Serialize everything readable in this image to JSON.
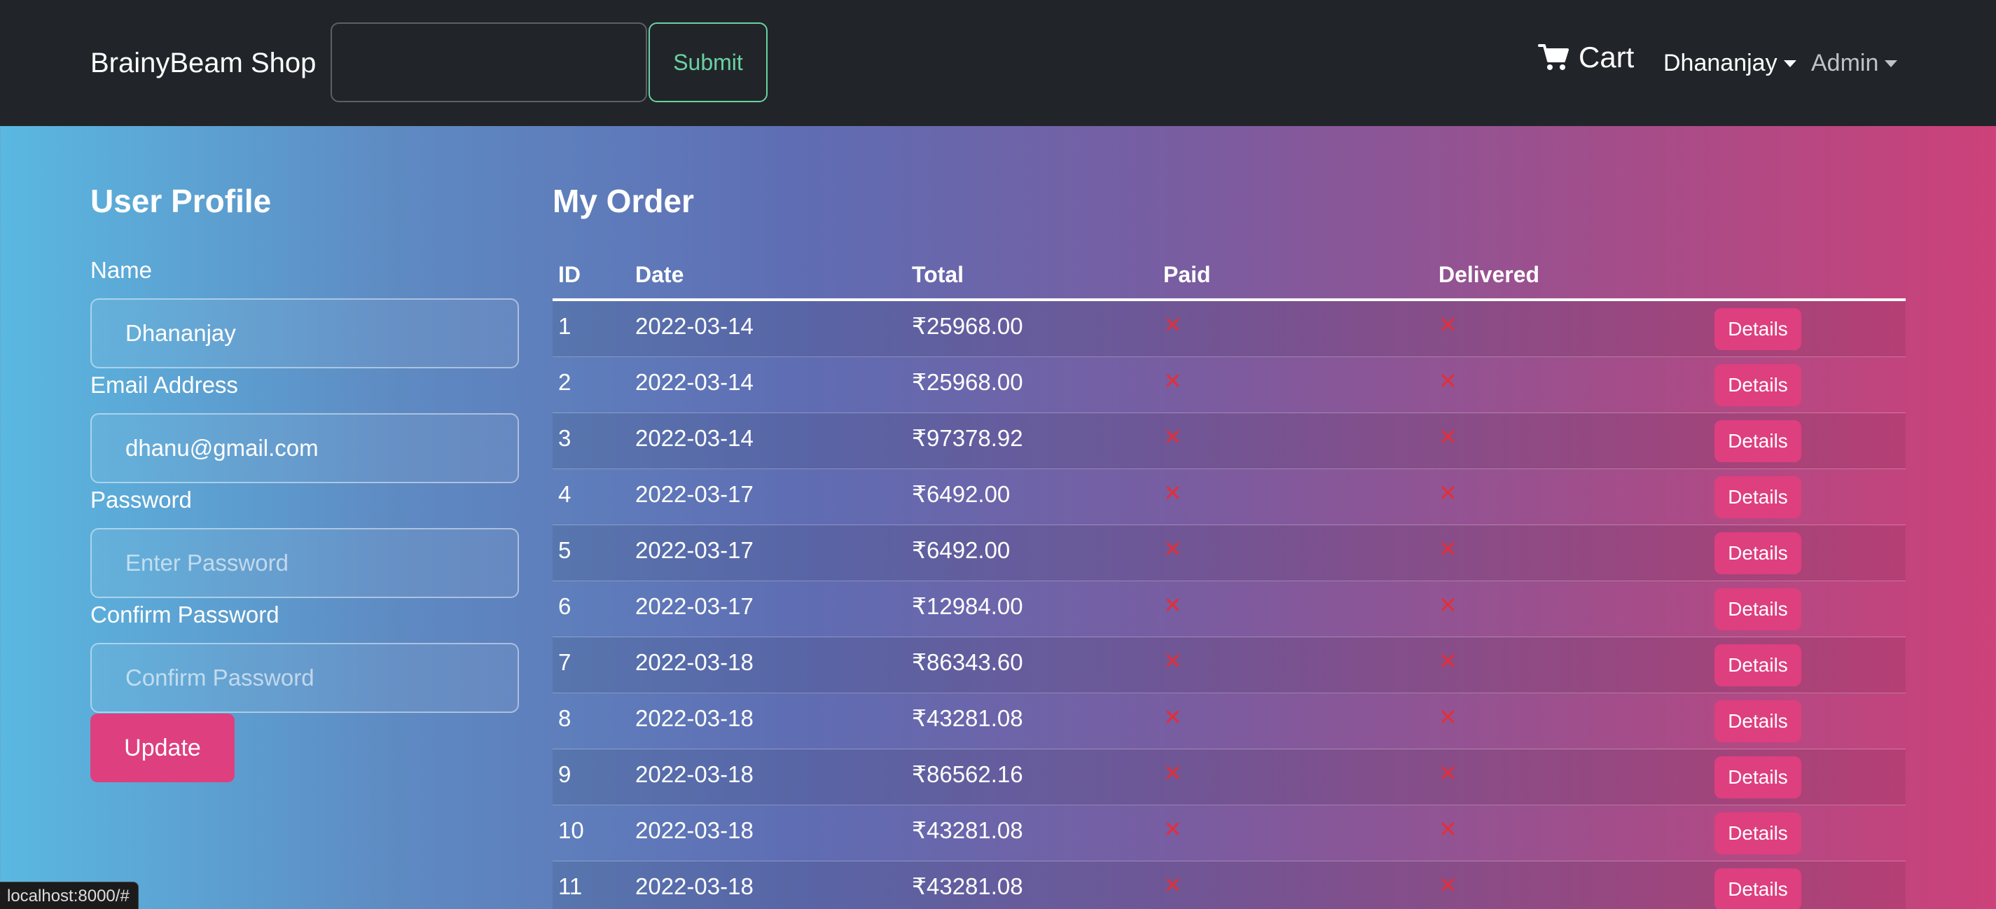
{
  "navbar": {
    "brand": "BrainyBeam Shop",
    "search_value": "",
    "submit_label": "Submit",
    "cart_label": "Cart",
    "user_label": "Dhananjay",
    "admin_label": "Admin"
  },
  "profile": {
    "title": "User Profile",
    "name_label": "Name",
    "name_value": "Dhananjay",
    "email_label": "Email Address",
    "email_value": "dhanu@gmail.com",
    "password_label": "Password",
    "password_placeholder": "Enter Password",
    "confirm_label": "Confirm Password",
    "confirm_placeholder": "Confirm Password",
    "update_label": "Update"
  },
  "orders": {
    "title": "My Order",
    "columns": [
      "ID",
      "Date",
      "Total",
      "Paid",
      "Delivered"
    ],
    "details_label": "Details",
    "status_mark": "✕",
    "rows": [
      {
        "id": "1",
        "date": "2022-03-14",
        "total": "₹25968.00",
        "paid": false,
        "delivered": false
      },
      {
        "id": "2",
        "date": "2022-03-14",
        "total": "₹25968.00",
        "paid": false,
        "delivered": false
      },
      {
        "id": "3",
        "date": "2022-03-14",
        "total": "₹97378.92",
        "paid": false,
        "delivered": false
      },
      {
        "id": "4",
        "date": "2022-03-17",
        "total": "₹6492.00",
        "paid": false,
        "delivered": false
      },
      {
        "id": "5",
        "date": "2022-03-17",
        "total": "₹6492.00",
        "paid": false,
        "delivered": false
      },
      {
        "id": "6",
        "date": "2022-03-17",
        "total": "₹12984.00",
        "paid": false,
        "delivered": false
      },
      {
        "id": "7",
        "date": "2022-03-18",
        "total": "₹86343.60",
        "paid": false,
        "delivered": false
      },
      {
        "id": "8",
        "date": "2022-03-18",
        "total": "₹43281.08",
        "paid": false,
        "delivered": false
      },
      {
        "id": "9",
        "date": "2022-03-18",
        "total": "₹86562.16",
        "paid": false,
        "delivered": false
      },
      {
        "id": "10",
        "date": "2022-03-18",
        "total": "₹43281.08",
        "paid": false,
        "delivered": false
      },
      {
        "id": "11",
        "date": "2022-03-18",
        "total": "₹43281.08",
        "paid": false,
        "delivered": false
      }
    ]
  },
  "status_bar": {
    "url": "localhost:8000/#"
  },
  "colors": {
    "navbar_bg": "#212529",
    "accent_pink": "#de3f7e",
    "submit_green": "#6ad1a2",
    "cross_red": "#e0303a"
  }
}
